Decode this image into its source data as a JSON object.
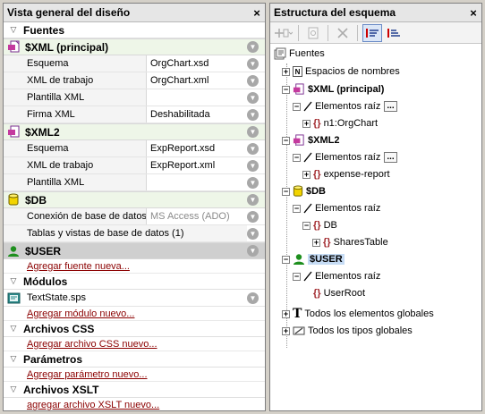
{
  "overview": {
    "title": "Vista general del diseño",
    "close_glyph": "×",
    "sources_heading": "Fuentes",
    "sources": [
      {
        "name": "$XML (principal)",
        "icon": "xml-file-icon",
        "props": [
          {
            "label": "Esquema",
            "value": "OrgChart.xsd"
          },
          {
            "label": "XML de trabajo",
            "value": "OrgChart.xml"
          },
          {
            "label": "Plantilla XML",
            "value": ""
          },
          {
            "label": "Firma XML",
            "value": "Deshabilitada"
          }
        ]
      },
      {
        "name": "$XML2",
        "icon": "xml-file-icon",
        "props": [
          {
            "label": "Esquema",
            "value": "ExpReport.xsd"
          },
          {
            "label": "XML de trabajo",
            "value": "ExpReport.xml"
          },
          {
            "label": "Plantilla XML",
            "value": ""
          }
        ]
      },
      {
        "name": "$DB",
        "icon": "database-icon",
        "props": [
          {
            "label": "Conexión de base de datos",
            "value": "MS Access (ADO)"
          },
          {
            "label": "Tablas y vistas de base de datos (1)",
            "value": ""
          }
        ]
      },
      {
        "name": "$USER",
        "icon": "user-icon",
        "props": []
      }
    ],
    "add_source": "Agregar fuente nueva...",
    "modules_heading": "Módulos",
    "module_file": "TextState.sps",
    "add_module": "Agregar módulo nuevo...",
    "css_heading": "Archivos CSS",
    "add_css": "Agregar archivo CSS nuevo...",
    "params_heading": "Parámetros",
    "add_param": "Agregar parámetro nuevo...",
    "xslt_heading": "Archivos XSLT",
    "add_xslt": "agregar archivo XSLT nuevo...",
    "arrow_glyph": "▽",
    "down_glyph": "▼"
  },
  "tree": {
    "title": "Estructura del esquema",
    "close_glyph": "×",
    "root": "Fuentes",
    "namespaces": "Espacios de nombres",
    "xml_main": "$XML (principal)",
    "root_elements": "Elementos raíz",
    "xml_main_root": "n1:OrgChart",
    "xml2": "$XML2",
    "xml2_root": "expense-report",
    "db": "$DB",
    "db_node": "DB",
    "db_table": "SharesTable",
    "user": "$USER",
    "user_root": "UserRoot",
    "all_elements": "Todos los elementos globales",
    "all_types": "Todos los tipos globales",
    "ellipsis": "...",
    "plus": "+",
    "minus": "−",
    "ns_letter": "N",
    "t_letter": "T",
    "brace": "{}"
  },
  "colors": {
    "accent_red": "#8b0000",
    "user_green": "#1e8f1e",
    "db_yellow": "#e8c800",
    "selection": "#c6dcf5"
  }
}
